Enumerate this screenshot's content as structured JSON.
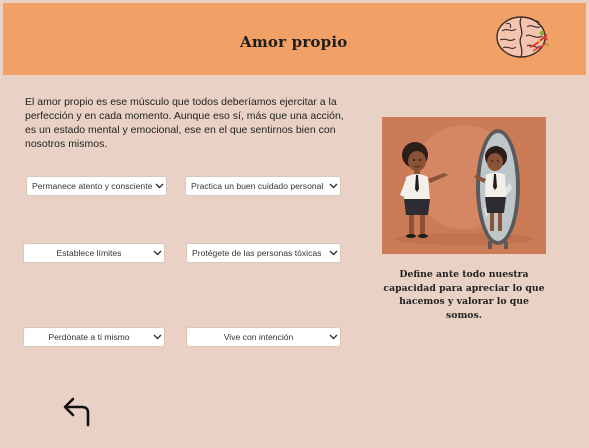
{
  "header": {
    "title": "Amor propio",
    "logo_icon": "brain-icon"
  },
  "intro": {
    "text": "El amor propio es ese músculo que todos deberíamos ejercitar a la perfección y en cada momento. Aunque eso sí, más que una acción, es un estado mental y emocional, ese en el que sentirnos bien con nosotros mismos."
  },
  "dropdowns": [
    {
      "label": "Permanece atento y consciente"
    },
    {
      "label": "Practica un buen cuidado personal"
    },
    {
      "label": "Establece límites"
    },
    {
      "label": "Protégete de las personas tóxicas"
    },
    {
      "label": "Perdónate a ti mismo"
    },
    {
      "label": "Vive con intención"
    }
  ],
  "illustration": {
    "icon": "woman-mirror-illustration",
    "background": "#cc7b57"
  },
  "caption": {
    "text": "Define ante todo nuestra capacidad para apreciar lo que hacemos y valorar lo que somos."
  },
  "navigation": {
    "back_icon": "return-arrow-icon"
  },
  "colors": {
    "header_bg": "#f2a166",
    "page_bg": "#e9d2c5",
    "dropdown_bg": "#ffffff"
  }
}
